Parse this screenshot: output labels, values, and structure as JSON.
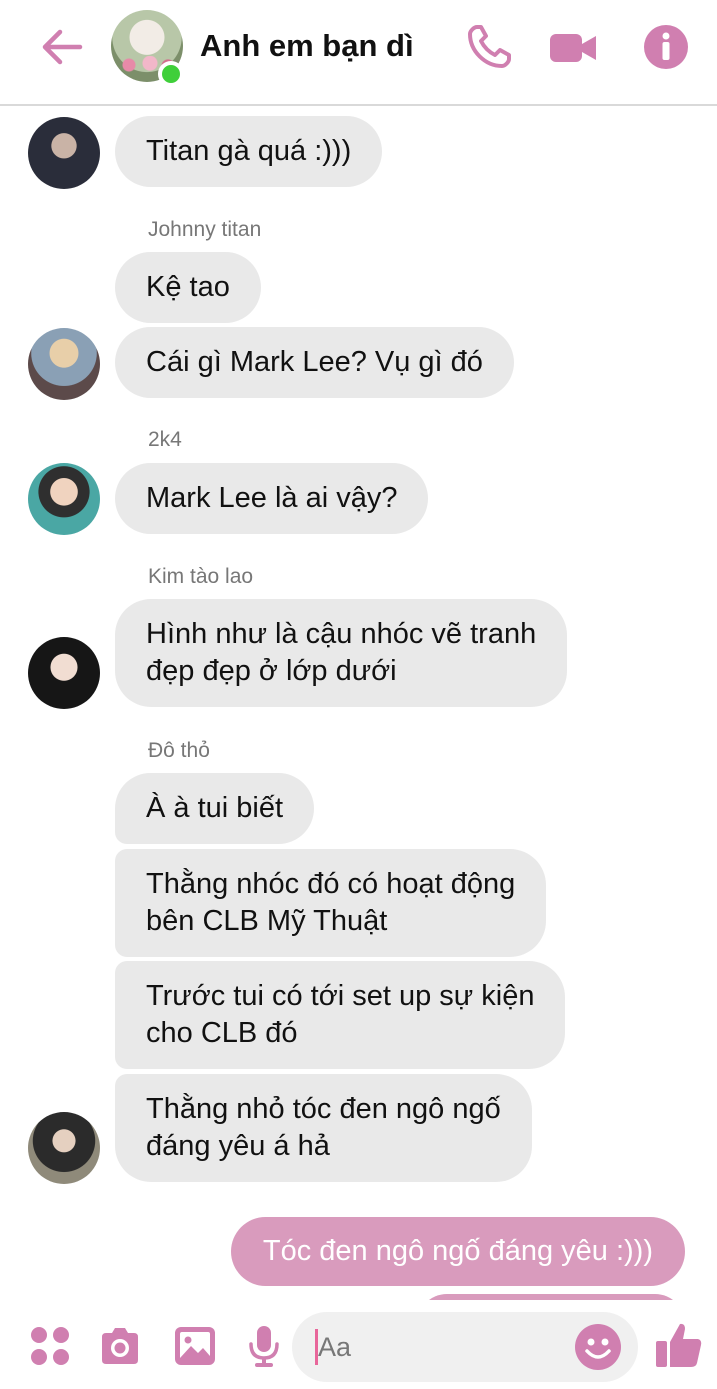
{
  "header": {
    "title": "Anh em bạn dì",
    "icons": [
      "back-arrow-icon",
      "phone-icon",
      "video-camera-icon",
      "info-icon"
    ]
  },
  "colors": {
    "accent": "#d07fb0",
    "bubble_other": "#e9e9e9",
    "bubble_mine": "#d99bbd",
    "online": "#3fcf3a"
  },
  "messages": [
    {
      "sender": "",
      "text": "Titan gà quá :)))"
    },
    {
      "sender": "Johnny titan",
      "texts": [
        "Kệ tao",
        "Cái gì Mark Lee? Vụ gì đó"
      ]
    },
    {
      "sender": "2k4",
      "text": "Mark Lee là ai vậy?"
    },
    {
      "sender": "Kim tào lao",
      "lines": [
        "Hình như là cậu nhóc vẽ tranh",
        "đẹp đẹp ở lớp dưới"
      ]
    },
    {
      "sender": "Đô thỏ",
      "items": [
        {
          "lines": [
            "À à tui biết"
          ]
        },
        {
          "lines": [
            "Thằng nhóc đó có hoạt động",
            "bên CLB Mỹ Thuật"
          ]
        },
        {
          "lines": [
            "Trước tui có tới set up sự kiện",
            "cho CLB đó"
          ]
        },
        {
          "lines": [
            "Thằng nhỏ tóc đen ngô ngố",
            "đáng yêu á hả"
          ]
        }
      ]
    },
    {
      "sender": "me",
      "text": "Tóc đen ngô ngố đáng yêu :)))"
    }
  ],
  "composer": {
    "placeholder": "Aa"
  }
}
